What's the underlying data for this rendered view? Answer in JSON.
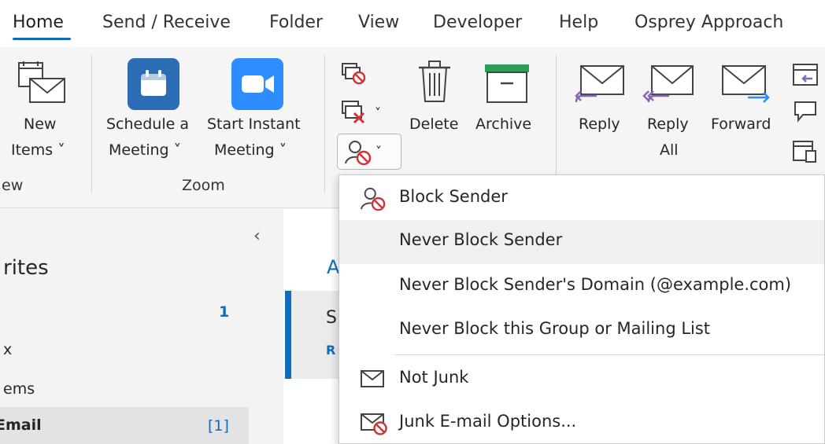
{
  "tabs": [
    "Home",
    "Send / Receive",
    "Folder",
    "View",
    "Developer",
    "Help",
    "Osprey Approach"
  ],
  "ribbon": {
    "new_items": [
      "New",
      "Items ˅"
    ],
    "new_group_partial": "ew",
    "schedule_meeting": [
      "Schedule a",
      "Meeting ˅"
    ],
    "start_instant": [
      "Start Instant",
      "Meeting ˅"
    ],
    "zoom_group": "Zoom",
    "delete": "Delete",
    "archive": "Archive",
    "reply": "Reply",
    "reply_all": [
      "Reply",
      "All"
    ],
    "forward": "Forward",
    "chevron": "˅"
  },
  "leftnav": {
    "collapse_glyph": "‹",
    "favorites_partial": "rites",
    "count_1": "1",
    "inbox_partial": "x",
    "items_partial": "ems",
    "email_partial": "Email",
    "email_count": "[1]"
  },
  "middle": {
    "header_partial": "A",
    "row_letter_1": "S",
    "row_letter_2": "R"
  },
  "menu": {
    "items": [
      {
        "label": "Block Sender",
        "icon": "block-person-icon"
      },
      {
        "label": "Never Block Sender",
        "icon": ""
      },
      {
        "label": "Never Block Sender's Domain (@example.com)",
        "icon": ""
      },
      {
        "label": "Never Block this Group or Mailing List",
        "icon": ""
      },
      {
        "label": "Not Junk",
        "icon": "envelope-icon"
      },
      {
        "label": "Junk E-mail Options...",
        "icon": "envelope-block-icon"
      }
    ]
  },
  "colors": {
    "accent": "#0f6cbd",
    "block_red": "#d13438",
    "teams_blue": "#2b6cb4",
    "zoom_blue": "#2d8cff",
    "archive_green": "#2e9e5b",
    "reply_purple": "#8764b8"
  }
}
